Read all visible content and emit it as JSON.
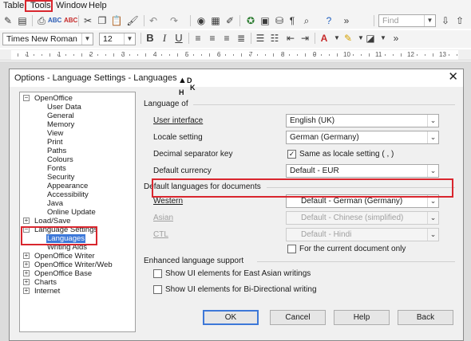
{
  "menubar": {
    "items": [
      {
        "label": "Table"
      },
      {
        "label": "Tools"
      },
      {
        "label": "Window"
      },
      {
        "label": "Help"
      }
    ]
  },
  "toolbar": {
    "font_name": "Times New Roman",
    "font_size": "12",
    "find_placeholder": "Find",
    "bold": "B",
    "italic": "I",
    "underline": "U"
  },
  "ruler": {
    "numbers": [
      "1",
      "1",
      "2",
      "3",
      "4",
      "5",
      "6",
      "7",
      "8",
      "9",
      "10",
      "11",
      "12",
      "13"
    ]
  },
  "cursor_glyphs": {
    "a": "D",
    "b": "K",
    "c": "H"
  },
  "dialog": {
    "title": "Options - Language Settings - Languages",
    "close": "✕",
    "tree": [
      {
        "label": "OpenOffice",
        "expander": "−"
      },
      {
        "label": "User Data"
      },
      {
        "label": "General"
      },
      {
        "label": "Memory"
      },
      {
        "label": "View"
      },
      {
        "label": "Print"
      },
      {
        "label": "Paths"
      },
      {
        "label": "Colours"
      },
      {
        "label": "Fonts"
      },
      {
        "label": "Security"
      },
      {
        "label": "Appearance"
      },
      {
        "label": "Accessibility"
      },
      {
        "label": "Java"
      },
      {
        "label": "Online Update"
      },
      {
        "label": "Load/Save",
        "expander": "+"
      },
      {
        "label": "Language Settings",
        "expander": "−"
      },
      {
        "label": "Languages",
        "selected": true
      },
      {
        "label": "Writing Aids"
      },
      {
        "label": "OpenOffice Writer",
        "expander": "+"
      },
      {
        "label": "OpenOffice Writer/Web",
        "expander": "+"
      },
      {
        "label": "OpenOffice Base",
        "expander": "+"
      },
      {
        "label": "Charts",
        "expander": "+"
      },
      {
        "label": "Internet",
        "expander": "+"
      }
    ],
    "language_of": {
      "title": "Language of",
      "user_interface_label": "User interface",
      "user_interface_value": "English (UK)",
      "locale_label": "Locale setting",
      "locale_value": "German (Germany)",
      "decimal_label": "Decimal separator key",
      "decimal_checkbox_label": "Same as locale setting ( , )",
      "decimal_checked": true,
      "currency_label": "Default currency",
      "currency_value": "Default - EUR"
    },
    "default_languages": {
      "title": "Default languages for documents",
      "western_label": "Western",
      "western_value": "Default - German (Germany)",
      "asian_label": "Asian",
      "asian_value": "Default - Chinese (simplified)",
      "ctl_label": "CTL",
      "ctl_value": "Default - Hindi",
      "current_doc_label": "For the current document only",
      "current_doc_checked": false
    },
    "enhanced": {
      "title": "Enhanced language support",
      "east_asian_label": "Show UI elements for East Asian writings",
      "east_asian_checked": false,
      "bidi_label": "Show UI elements for Bi-Directional writing",
      "bidi_checked": false
    },
    "buttons": {
      "ok": "OK",
      "cancel": "Cancel",
      "help": "Help",
      "back": "Back"
    }
  },
  "colors": {
    "highlight_box": "#d9262e",
    "selection": "#3d78d8"
  }
}
